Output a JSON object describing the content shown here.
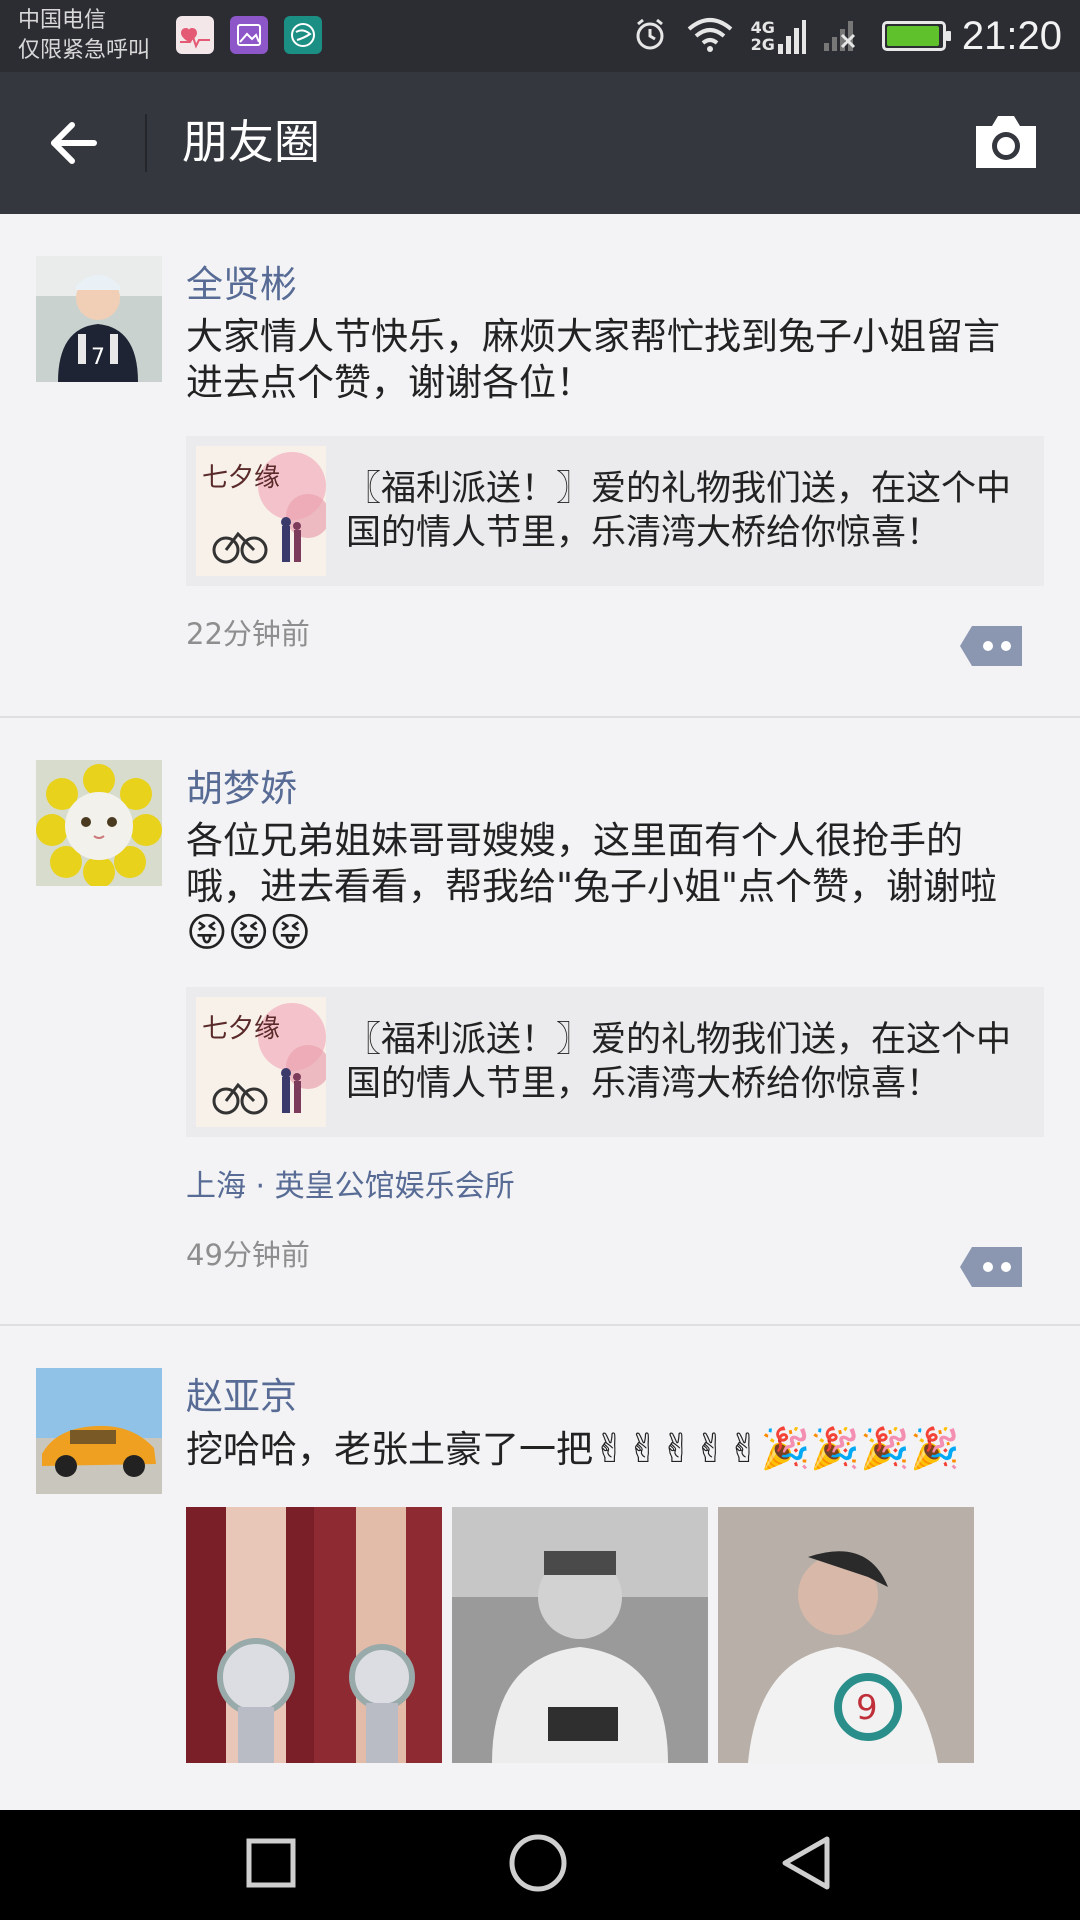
{
  "status_bar": {
    "carrier_line1": "中国电信",
    "carrier_line2": "仅限紧急呼叫",
    "net_4g": "4G",
    "net_2g": "2G",
    "time": "21:20",
    "battery_level": 0.9,
    "icons": [
      "health-app-icon",
      "gallery-app-icon",
      "browser-app-icon",
      "alarm-icon",
      "wifi-icon",
      "signal-icon",
      "no-signal-icon",
      "battery-charging-icon"
    ]
  },
  "header": {
    "back_icon": "arrow-left-icon",
    "title": "朋友圈",
    "camera_icon": "camera-icon"
  },
  "posts": [
    {
      "nickname": "全贤彬",
      "text": "大家情人节快乐，麻烦大家帮忙找到兔子小姐留言进去点个赞，谢谢各位！",
      "link": {
        "title": "〖福利派送！〗爱的礼物我们送，在这个中国的情人节里，乐清湾大桥给你惊喜！"
      },
      "time": "22分钟前"
    },
    {
      "nickname": "胡梦娇",
      "text": "各位兄弟姐妹哥哥嫂嫂，这里面有个人很抢手的哦，进去看看，帮我给\"兔子小姐\"点个赞，谢谢啦",
      "emojis": "😝😝😝",
      "link": {
        "title": "〖福利派送！〗爱的礼物我们送，在这个中国的情人节里，乐清湾大桥给你惊喜！"
      },
      "location": "上海 · 英皇公馆娱乐会所",
      "time": "49分钟前"
    },
    {
      "nickname": "赵亚京",
      "text": "挖哈哈，老张土豪了一把",
      "emojis": "✌✌✌✌✌🎉🎉🎉🎉"
    }
  ],
  "navigation": {
    "icons": [
      "recent-apps-icon",
      "home-icon",
      "back-triangle-icon"
    ]
  }
}
